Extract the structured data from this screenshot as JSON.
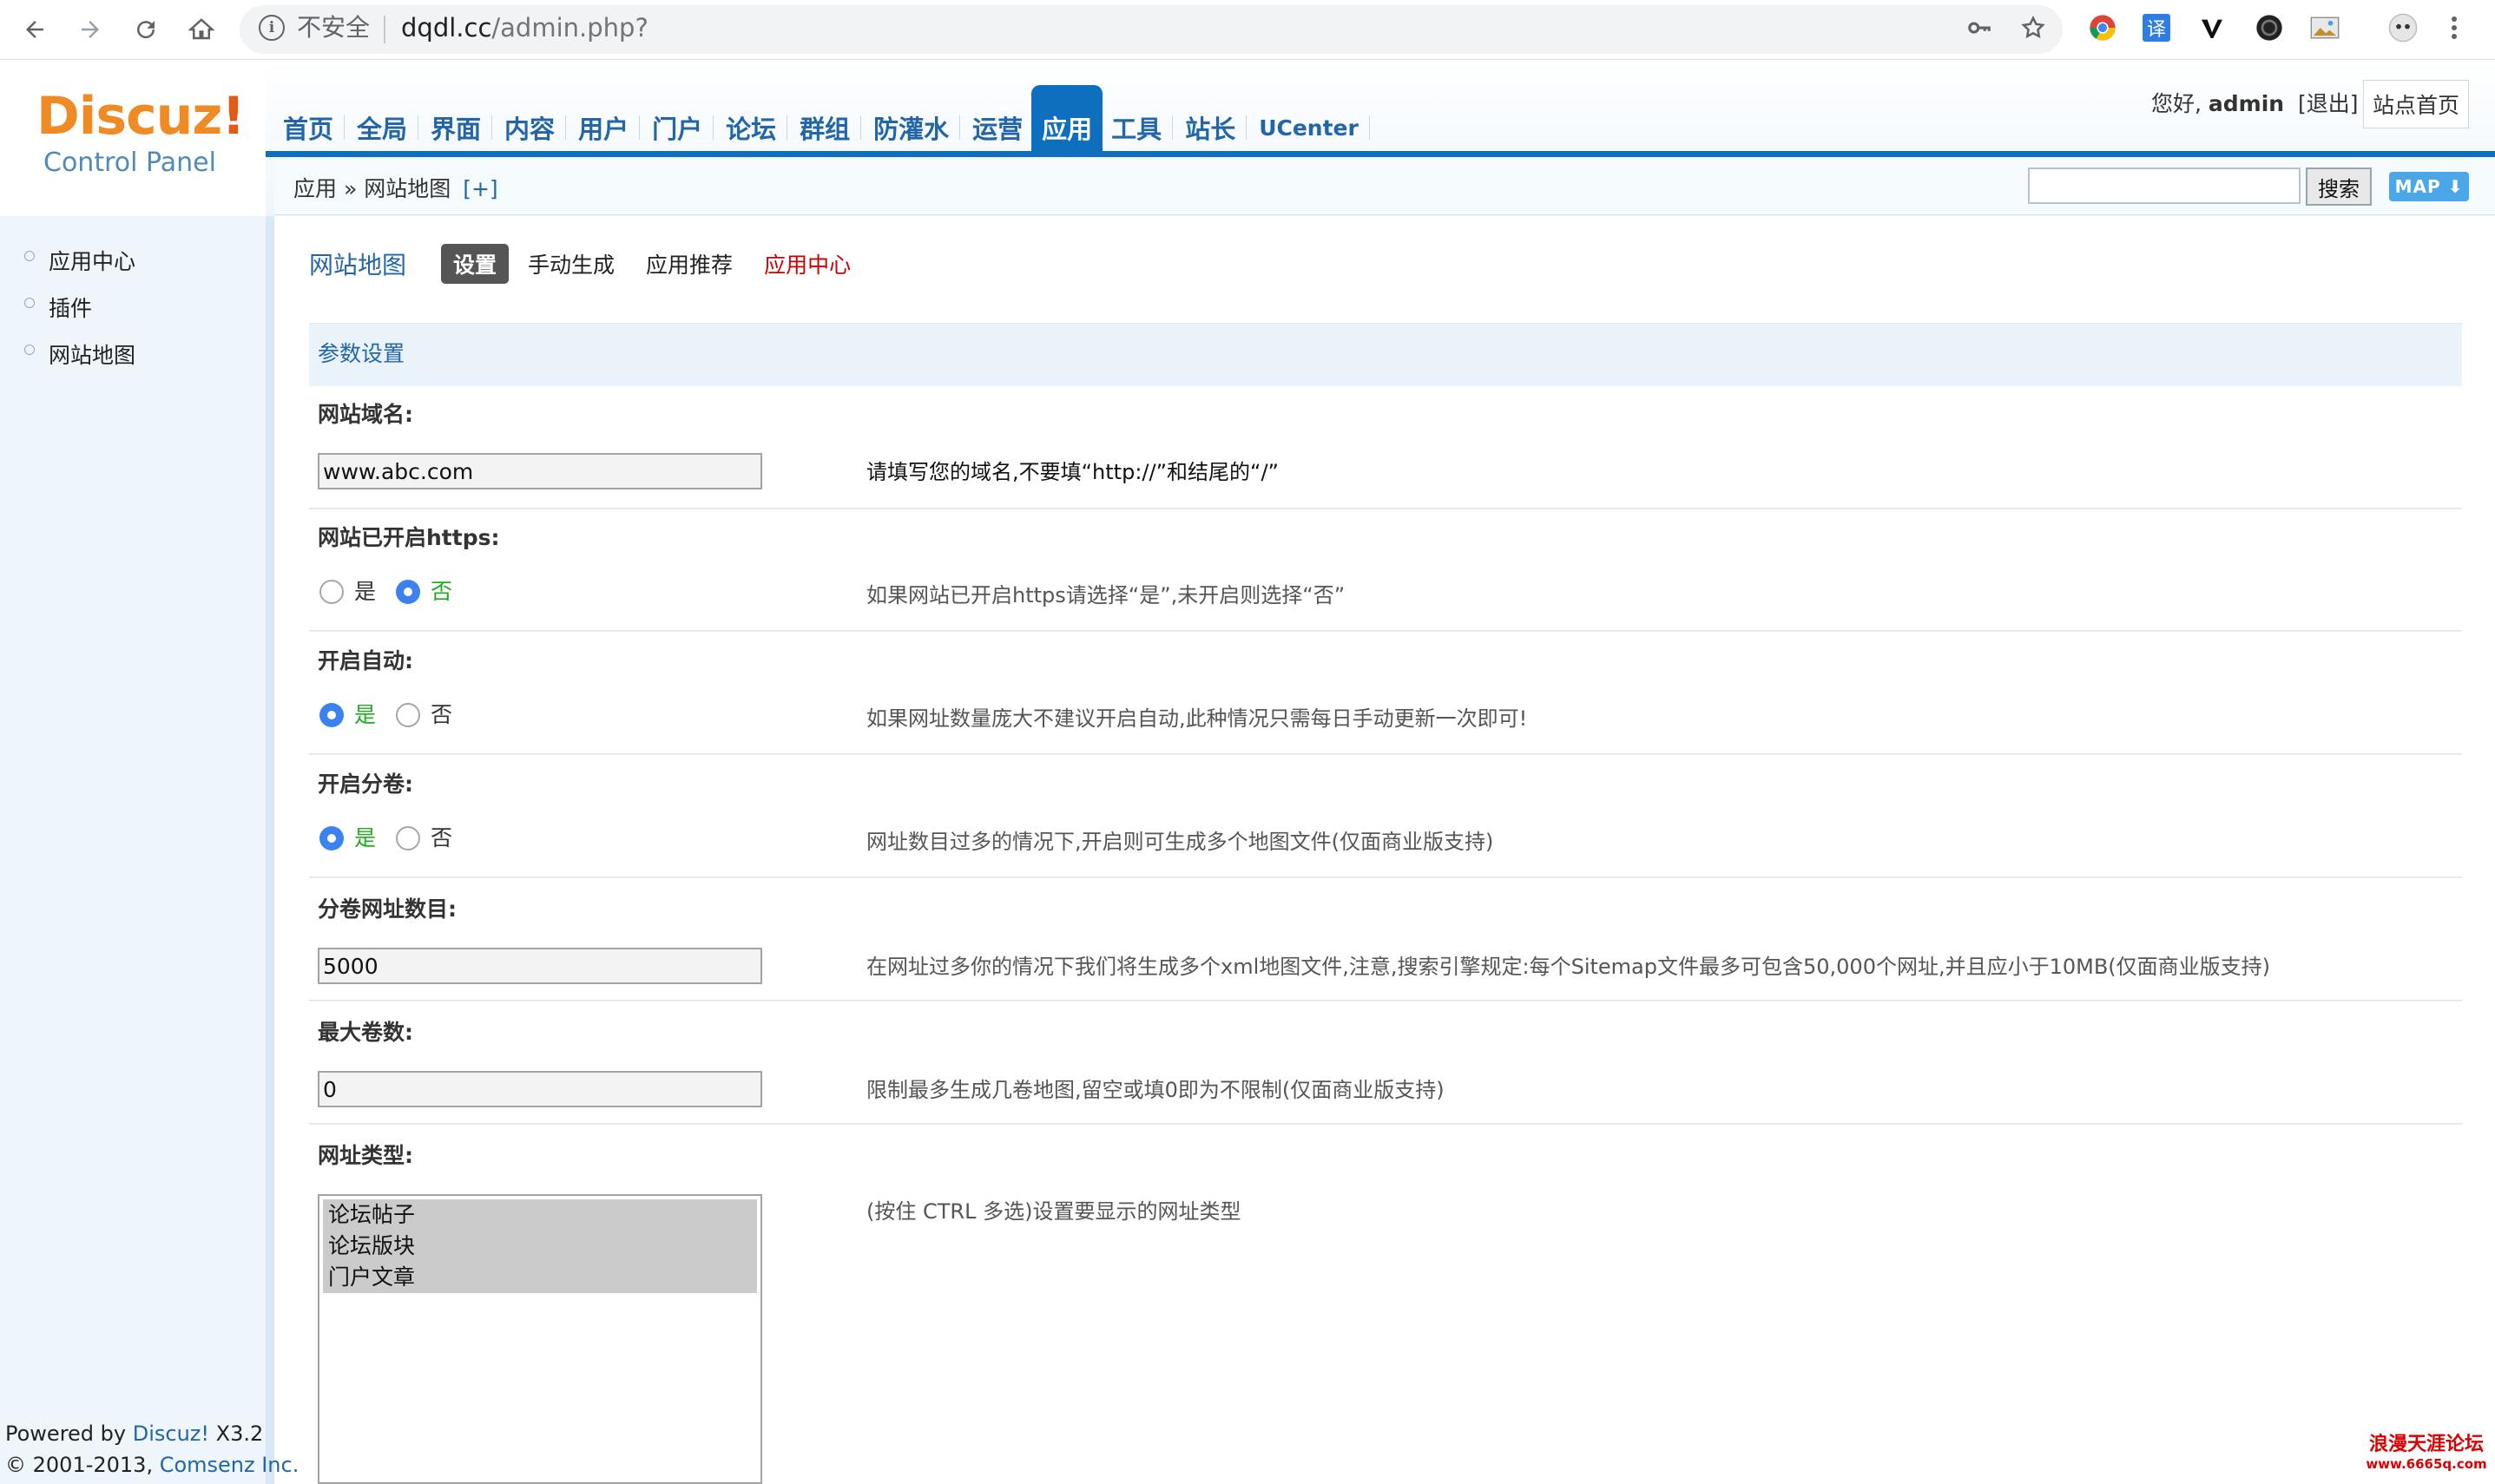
{
  "browser": {
    "insecure_label": "不安全",
    "url_host": "dqdl.cc",
    "url_path": "/admin.php?",
    "translate_icon_text": "译"
  },
  "header": {
    "logo_text": "Discuz",
    "logo_bang": "!",
    "logo_sub": "Control Panel",
    "nav": [
      {
        "label": "首页"
      },
      {
        "label": "全局"
      },
      {
        "label": "界面"
      },
      {
        "label": "内容"
      },
      {
        "label": "用户"
      },
      {
        "label": "门户"
      },
      {
        "label": "论坛"
      },
      {
        "label": "群组"
      },
      {
        "label": "防灌水"
      },
      {
        "label": "运营"
      },
      {
        "label": "应用",
        "active": true
      },
      {
        "label": "工具"
      },
      {
        "label": "站长"
      },
      {
        "label": "UCenter"
      }
    ],
    "greeting": "您好,",
    "username": "admin",
    "logout": "[退出]",
    "home_button": "站点首页"
  },
  "breadcrumb": {
    "text": "应用 » 网站地图",
    "plus": "[+]"
  },
  "search": {
    "value": "",
    "button": "搜索",
    "map_button": "MAP ⬇"
  },
  "sidebar": {
    "items": [
      {
        "label": "应用中心"
      },
      {
        "label": "插件"
      },
      {
        "label": "网站地图"
      }
    ],
    "powered_prefix": "Powered by ",
    "powered_brand": "Discuz!",
    "powered_version": " X3.2",
    "copyright_prefix": "© 2001-2013, ",
    "copyright_company": "Comsenz Inc."
  },
  "page": {
    "title": "网站地图",
    "tabs": [
      {
        "label": "设置",
        "current": true
      },
      {
        "label": "手动生成"
      },
      {
        "label": "应用推荐"
      },
      {
        "label": "应用中心",
        "highlight": true
      }
    ],
    "section_title": "参数设置"
  },
  "form": {
    "domain": {
      "label": "网站域名:",
      "value": "www.abc.com",
      "tip": "请填写您的域名,不要填“http://”和结尾的“/”"
    },
    "https": {
      "label": "网站已开启https:",
      "yes": "是",
      "no": "否",
      "selected": "no",
      "tip": "如果网站已开启https请选择“是”,未开启则选择“否”"
    },
    "auto": {
      "label": "开启自动:",
      "yes": "是",
      "no": "否",
      "selected": "yes",
      "tip": "如果网址数量庞大不建议开启自动,此种情况只需每日手动更新一次即可!"
    },
    "split": {
      "label": "开启分卷:",
      "yes": "是",
      "no": "否",
      "selected": "yes",
      "tip": "网址数目过多的情况下,开启则可生成多个地图文件(仅面商业版支持)"
    },
    "split_count": {
      "label": "分卷网址数目:",
      "value": "5000",
      "tip": "在网址过多你的情况下我们将生成多个xml地图文件,注意,搜索引擎规定:每个Sitemap文件最多可包含50,000个网址,并且应小于10MB(仅面商业版支持)"
    },
    "max_volumes": {
      "label": "最大卷数:",
      "value": "0",
      "tip": "限制最多生成几卷地图,留空或填0即为不限制(仅面商业版支持)"
    },
    "url_types": {
      "label": "网址类型:",
      "options": [
        "论坛帖子",
        "论坛版块",
        "门户文章"
      ],
      "tip": "(按住 CTRL 多选)设置要显示的网址类型"
    }
  },
  "watermark": {
    "text": "浪漫天涯论坛",
    "url": "www.6665q.com"
  },
  "colors": {
    "nav_active": "#0e6fbf",
    "link_blue": "#2366a8",
    "radio_on": "#3b82f0",
    "yes_green": "#22aa22",
    "app_center_red": "#cc0000"
  }
}
